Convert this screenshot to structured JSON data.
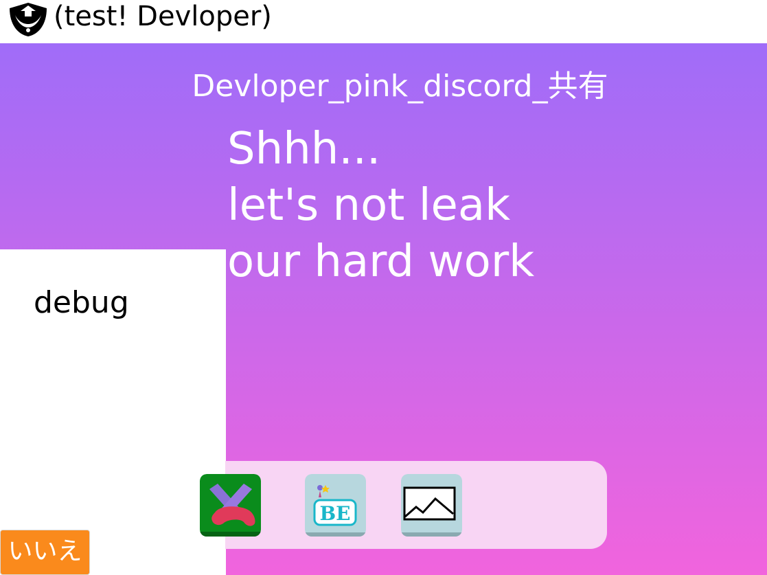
{
  "window": {
    "title": "(test!  Devloper)"
  },
  "stage": {
    "heading": "Devloper_pink_discord_共有",
    "message_lines": [
      "Shhh...",
      "let's not leak",
      "our hard work"
    ]
  },
  "side_panel": {
    "debug_label": "debug"
  },
  "dock": {
    "apps": [
      {
        "icon": "x-game-controller-icon"
      },
      {
        "icon": "be-app-icon"
      },
      {
        "icon": "image-viewer-icon"
      }
    ]
  },
  "buttons": {
    "no_label": "いいえ"
  },
  "colors": {
    "gradient_top": "#a06cf8",
    "gradient_bottom": "#f164dd",
    "dock_background": "#f8d5f4",
    "no_button": "#fa8a1c",
    "x_app_background": "#0a8c1c",
    "app_tile": "#b7d7de"
  }
}
